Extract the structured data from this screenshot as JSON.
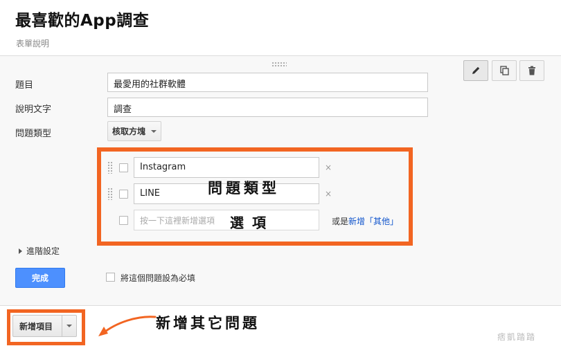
{
  "form": {
    "title": "最喜歡的App調查",
    "description": "表單說明"
  },
  "toolbar": {
    "edit_icon": "pencil-icon",
    "duplicate_icon": "copy-icon",
    "delete_icon": "trash-icon"
  },
  "question": {
    "title_label": "題目",
    "title_value": "最愛用的社群軟體",
    "help_label": "說明文字",
    "help_value": "調查",
    "type_label": "問題類型",
    "type_value": "核取方塊"
  },
  "options": [
    {
      "value": "Instagram",
      "remove": "×"
    },
    {
      "value": "LINE",
      "remove": "×"
    }
  ],
  "new_option": {
    "placeholder": "按一下這裡新增選項",
    "or_text": "或是",
    "add_other": "新增「其他」"
  },
  "annotations": {
    "question_type": "問題類型",
    "options": "選項",
    "add_question": "新增其它問題"
  },
  "advanced_label": "進階設定",
  "done_label": "完成",
  "required_label": "將這個問題設為必填",
  "add_item_label": "新增項目",
  "watermark": "痞凱踏踏",
  "colors": {
    "highlight": "#f26522",
    "primary_button": "#4d90fe",
    "link": "#1155cc"
  }
}
